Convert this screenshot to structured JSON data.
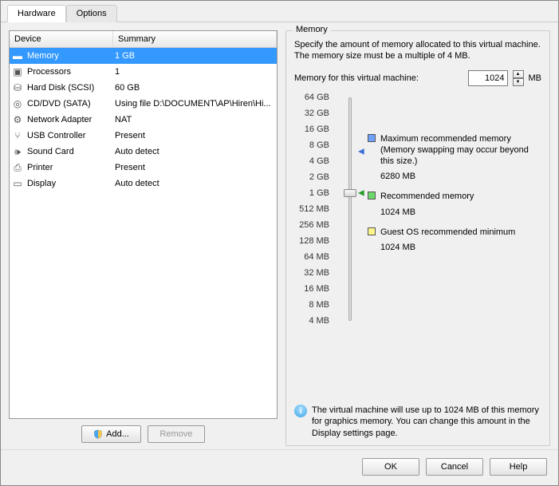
{
  "tabs": {
    "hardware": "Hardware",
    "options": "Options"
  },
  "table": {
    "headers": {
      "device": "Device",
      "summary": "Summary"
    },
    "rows": [
      {
        "icon": "memory-icon",
        "glyph": "▬",
        "device": "Memory",
        "summary": "1 GB",
        "selected": true
      },
      {
        "icon": "cpu-icon",
        "glyph": "▣",
        "device": "Processors",
        "summary": "1"
      },
      {
        "icon": "disk-icon",
        "glyph": "⛁",
        "device": "Hard Disk (SCSI)",
        "summary": "60 GB"
      },
      {
        "icon": "cd-icon",
        "glyph": "◎",
        "device": "CD/DVD (SATA)",
        "summary": "Using file D:\\DOCUMENT\\AP\\Hiren\\Hi..."
      },
      {
        "icon": "network-icon",
        "glyph": "⚙",
        "device": "Network Adapter",
        "summary": "NAT"
      },
      {
        "icon": "usb-icon",
        "glyph": "⑂",
        "device": "USB Controller",
        "summary": "Present"
      },
      {
        "icon": "sound-icon",
        "glyph": "🕪",
        "device": "Sound Card",
        "summary": "Auto detect"
      },
      {
        "icon": "printer-icon",
        "glyph": "⎙",
        "device": "Printer",
        "summary": "Present"
      },
      {
        "icon": "display-icon",
        "glyph": "▭",
        "device": "Display",
        "summary": "Auto detect"
      }
    ]
  },
  "leftButtons": {
    "add": "Add...",
    "remove": "Remove"
  },
  "memory": {
    "groupTitle": "Memory",
    "description": "Specify the amount of memory allocated to this virtual machine. The memory size must be a multiple of 4 MB.",
    "inputLabel": "Memory for this virtual machine:",
    "value": "1024",
    "unit": "MB",
    "ticks": [
      "64 GB",
      "32 GB",
      "16 GB",
      "8 GB",
      "4 GB",
      "2 GB",
      "1 GB",
      "512 MB",
      "256 MB",
      "128 MB",
      "64 MB",
      "32 MB",
      "16 MB",
      "8 MB",
      "4 MB"
    ],
    "thumbIndex": 6,
    "maxRec": {
      "label": "Maximum recommended memory",
      "note": "(Memory swapping may occur beyond this size.)",
      "value": "6280 MB",
      "tickIndex": 3.4
    },
    "rec": {
      "label": "Recommended memory",
      "value": "1024 MB",
      "tickIndex": 6
    },
    "guest": {
      "label": "Guest OS recommended minimum",
      "value": "1024 MB"
    },
    "info": "The virtual machine will use up to 1024 MB of this memory for graphics memory. You can change this amount in the Display settings page."
  },
  "footer": {
    "ok": "OK",
    "cancel": "Cancel",
    "help": "Help"
  }
}
